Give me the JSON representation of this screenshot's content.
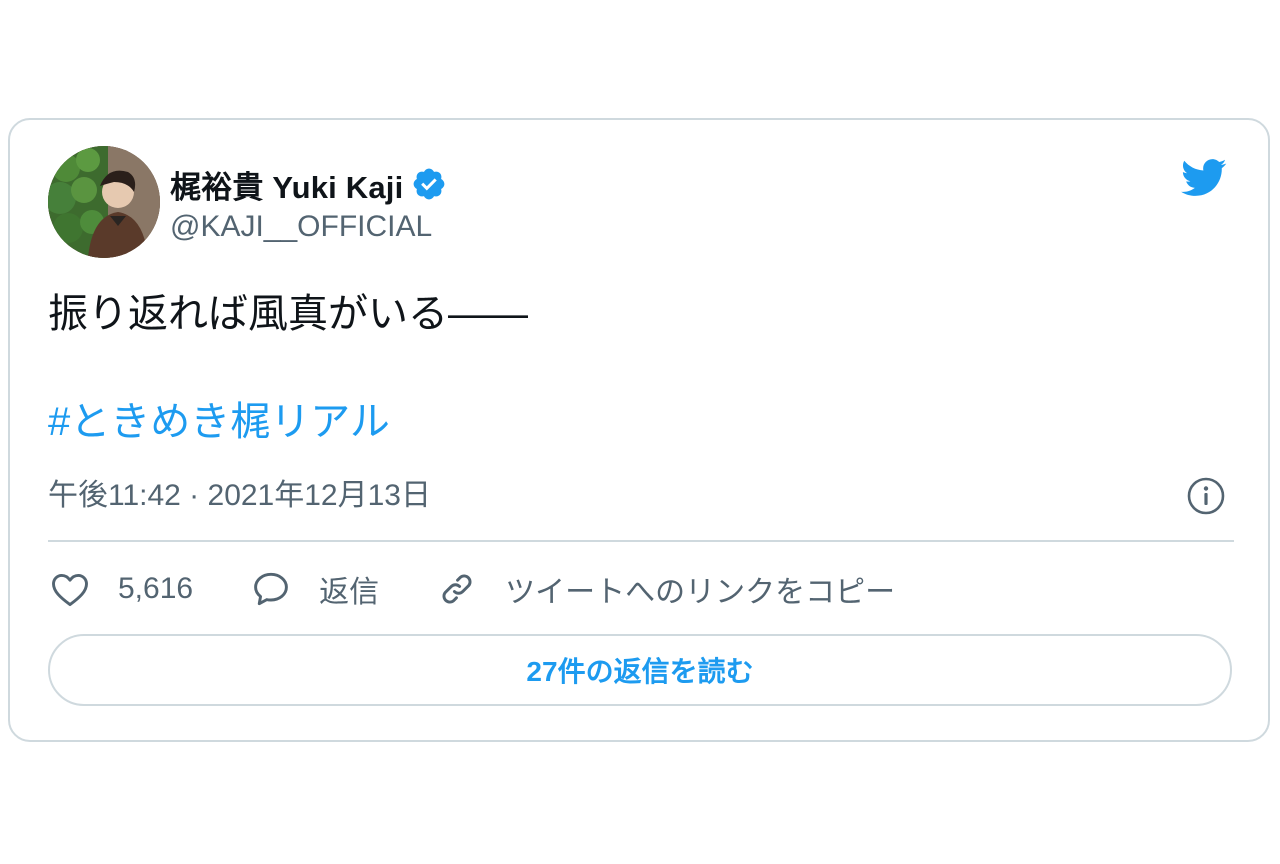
{
  "tweet": {
    "author": {
      "display_name": "梶裕貴 Yuki Kaji",
      "handle": "@KAJI__OFFICIAL",
      "verified": true
    },
    "text": "振り返れば風真がいる――",
    "hashtag": "#ときめき梶リアル",
    "timestamp": "午後11:42 · 2021年12月13日"
  },
  "actions": {
    "like_count": "5,616",
    "reply_label": "返信",
    "copy_link_label": "ツイートへのリンクをコピー"
  },
  "read_replies_label": "27件の返信を読む",
  "icons": {
    "bird": "twitter-bird-icon",
    "verified": "verified-badge-icon",
    "info": "info-icon",
    "heart": "heart-icon",
    "reply": "reply-bubble-icon",
    "link": "link-icon"
  },
  "colors": {
    "accent": "#1d9bf0",
    "text": "#0f1419",
    "secondary": "#536471",
    "border": "#cfd9de"
  }
}
